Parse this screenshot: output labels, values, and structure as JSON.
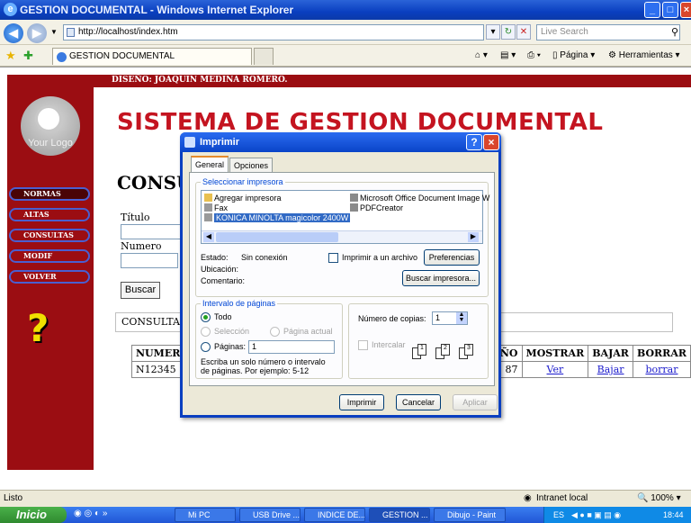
{
  "browser": {
    "title": "GESTION DOCUMENTAL - Windows Internet Explorer",
    "url": "http://localhost/index.htm",
    "search_placeholder": "Live Search",
    "tab_label": "GESTION DOCUMENTAL",
    "tools": {
      "pagina": "Página",
      "herramientas": "Herramientas"
    }
  },
  "page": {
    "design_credit": "DISEÑO: JOAQUIN MEDINA ROMERO.",
    "logo_text": "Your Logo",
    "title": "SISTEMA DE GESTION DOCUMENTAL",
    "section_heading": "CONSU",
    "menu": [
      "NORMAS",
      "ALTAS",
      "CONSULTAS",
      "MODIF",
      "VOLVER"
    ],
    "form": {
      "titulo_label": "Título",
      "numero_label": "Numero",
      "buscar": "Buscar"
    },
    "results_label": "CONSULTA",
    "table": {
      "headers": [
        "NUMERO",
        "AÑO",
        "MOSTRAR",
        "BAJAR",
        "BORRAR"
      ],
      "row": {
        "numero": "N12345",
        "anio": "87",
        "mostrar": "Ver",
        "bajar": "Bajar",
        "borrar": "borrar"
      }
    }
  },
  "dialog": {
    "title": "Imprimir",
    "tabs": [
      "General",
      "Opciones"
    ],
    "select_printer_legend": "Seleccionar impresora",
    "printers": [
      "Agregar impresora",
      "Microsoft Office Document Image W",
      "Fax",
      "PDFCreator",
      "KONICA MINOLTA magicolor 2400W"
    ],
    "estado_label": "Estado:",
    "estado_value": "Sin conexión",
    "ubicacion_label": "Ubicación:",
    "comentario_label": "Comentario:",
    "print_to_file": "Imprimir a un archivo",
    "preferencias": "Preferencias",
    "buscar_impresora": "Buscar impresora...",
    "range_legend": "Intervalo de páginas",
    "todo": "Todo",
    "seleccion": "Selección",
    "pagina_actual": "Página actual",
    "paginas": "Páginas:",
    "paginas_value": "1",
    "hint": "Escriba un solo número o intervalo de páginas. Por ejemplo: 5-12",
    "copias_label": "Número de copias:",
    "copias_value": "1",
    "intercalar": "Intercalar",
    "imprimir": "Imprimir",
    "cancelar": "Cancelar",
    "aplicar": "Aplicar"
  },
  "status": {
    "left": "Listo",
    "zone": "Intranet local",
    "zoom": "100%"
  },
  "taskbar": {
    "start": "Inicio",
    "tasks": [
      "Mi PC",
      "USB Drive ...",
      "INDICE DE...",
      "GESTION ...",
      "Dibujo - Paint"
    ],
    "lang": "ES",
    "clock": "18:44"
  }
}
